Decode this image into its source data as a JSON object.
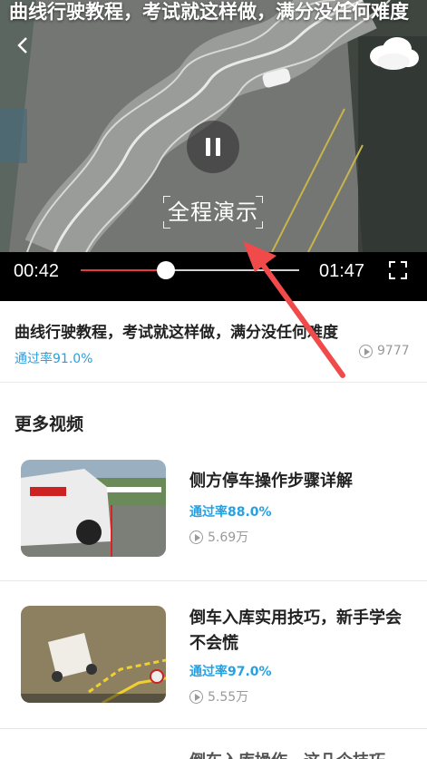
{
  "player": {
    "overlay_title": "曲线行驶教程，考试就这样做，满分没任何难度",
    "demo_label": "全程演示",
    "current_time": "00:42",
    "total_time": "01:47",
    "progress_fraction": 0.39,
    "accent_color": "#e83a3a",
    "icons": [
      "back-icon",
      "share-icon",
      "cloud-icon",
      "pause-icon",
      "fullscreen-icon"
    ]
  },
  "info": {
    "title": "曲线行驶教程，考试就这样做，满分没任何难度",
    "pass_rate": "通过率91.0%",
    "plays": "9777"
  },
  "more": {
    "section_title": "更多视频",
    "items": [
      {
        "title": "侧方停车操作步骤详解",
        "pass_rate": "通过率88.0%",
        "plays": "5.69万"
      },
      {
        "title": "倒车入库实用技巧，新手学会不会慌",
        "pass_rate": "通过率97.0%",
        "plays": "5.55万"
      },
      {
        "title": "倒车入库操作，这几个技巧",
        "pass_rate": "",
        "plays": ""
      }
    ]
  },
  "colors": {
    "pass_rate": "#27a0e0",
    "muted": "#999999",
    "annotation_arrow": "#f04a4a"
  }
}
